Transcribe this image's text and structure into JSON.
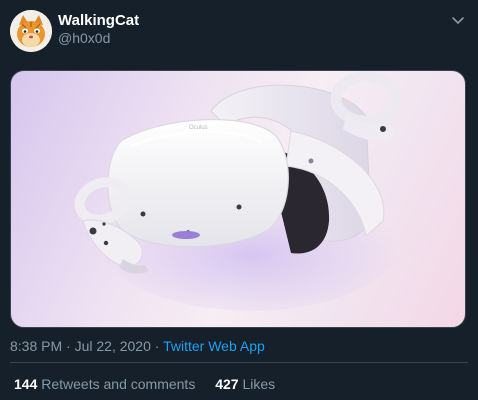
{
  "user": {
    "display_name": "WalkingCat",
    "handle": "@h0x0d",
    "avatar_icon": "cat-avatar-icon"
  },
  "menu_icon": "chevron-down-icon",
  "media": {
    "alt_icon": "vr-headset-image",
    "headset_brand": "Oculus"
  },
  "meta": {
    "time": "8:38 PM",
    "separator1": " · ",
    "date": "Jul 22, 2020",
    "separator2": " · ",
    "source": "Twitter Web App"
  },
  "stats": {
    "retweets_count": "144",
    "retweets_label": "Retweets and comments",
    "likes_count": "427",
    "likes_label": "Likes"
  },
  "colors": {
    "background": "#15202b",
    "accent": "#1da1f2",
    "muted": "#8899a6",
    "border": "#38444d"
  }
}
